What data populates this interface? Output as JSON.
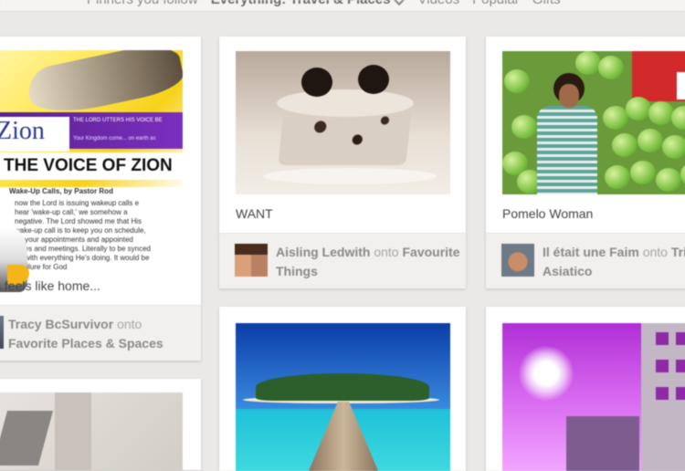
{
  "nav": {
    "items": [
      "Pinners you follow",
      "Everything: Travel & Places",
      "Videos",
      "Popular",
      "Gifts"
    ]
  },
  "pins": [
    {
      "description": "s feels like home...",
      "image_text": {
        "logo": "Zion",
        "tagline": "THE LORD UTTERS HIS VOICE BE",
        "subtitle": "Your Kingdom come... on earth as",
        "headline": "THE VOICE OF ZION",
        "byline": "Wake-Up Calls, by Pastor Rod",
        "body": "now the Lord is issuing wakeup calls e hear 'wake-up call,' we somehow a negative. The Lord showed me that His wake-up call is to keep you on schedule, on your appointments and appointed times and meetings. Literally to be synced up with everything He's doing. It would be a failure for God"
      },
      "pinner": "Tracy BcSurvivor",
      "onto": "onto",
      "board": "Favorite Places & Spaces"
    },
    {
      "description": "WANT",
      "pinner": "Aisling Ledwith",
      "onto": "onto",
      "board": "Favourite Things"
    },
    {
      "description": "Pomelo Woman",
      "pinner": "Il était une Faim",
      "onto": "onto",
      "board": "Trip Asiatico"
    }
  ],
  "colors": {
    "background": "#ebe9e7",
    "card": "#ffffff",
    "attribution_bg": "#f2f0ee",
    "attribution_text": "#8c8986"
  }
}
